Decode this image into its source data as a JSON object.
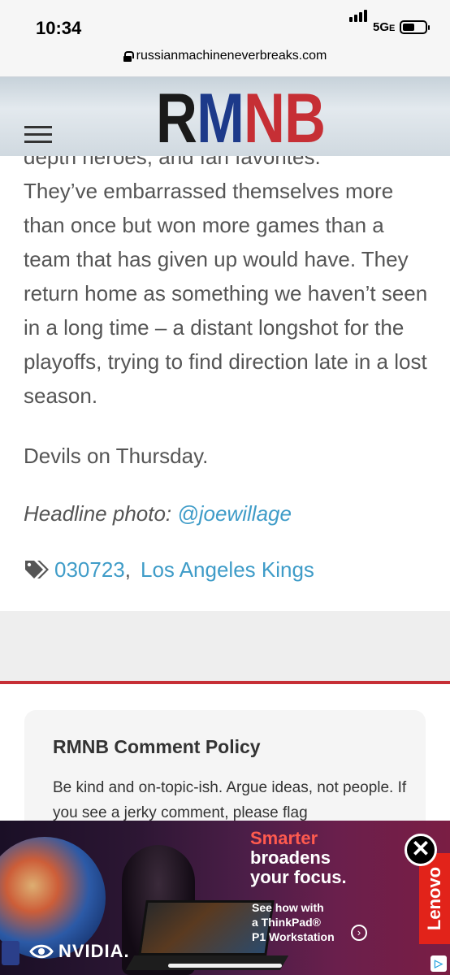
{
  "status_bar": {
    "time": "10:34",
    "network": "5G",
    "network_suffix": "E",
    "icons": [
      "signal-icon",
      "battery-icon"
    ]
  },
  "browser": {
    "url": "russianmachineneverbreaks.com",
    "icons": [
      "lock-icon"
    ]
  },
  "header": {
    "logo": {
      "letters": [
        "R",
        "M",
        "N",
        "B"
      ],
      "colors": [
        "#1a1a1a",
        "#1d3a8a",
        "#c62f35",
        "#c62f35"
      ]
    },
    "icons": [
      "hamburger-icon"
    ]
  },
  "article": {
    "cut_line": "depth heroes, and fan favorites.",
    "paragraph": "They’ve embarrassed themselves more than once but won more games than a team that has given up would have. They return home as something we haven’t seen in a long time – a distant longshot for the playoffs, trying to find direction late in a lost season.",
    "devils": "Devils on Thursday.",
    "credit_label": "Headline photo: ",
    "credit_link": "@joewillage",
    "tags": [
      "030723",
      "Los Angeles Kings"
    ],
    "tag_separator": ","
  },
  "comments": {
    "policy_title": "RMNB Comment Policy",
    "policy_text": "Be kind and on-topic-ish. Argue ideas, not people. If you see a jerky comment, please flag"
  },
  "ad": {
    "headline": [
      "Smarter",
      "broadens",
      "your focus."
    ],
    "cta": [
      "See how with",
      "a ThinkPad®",
      "P1 Workstation"
    ],
    "brand": "Lenovo",
    "sponsor": "NVIDIA.",
    "close": "✕",
    "adchoices": "▷"
  },
  "colors": {
    "link": "#3f9cc8",
    "accent_red": "#c62f35",
    "ad_headline": "#ff5a4e",
    "brand_red": "#e2231a"
  }
}
